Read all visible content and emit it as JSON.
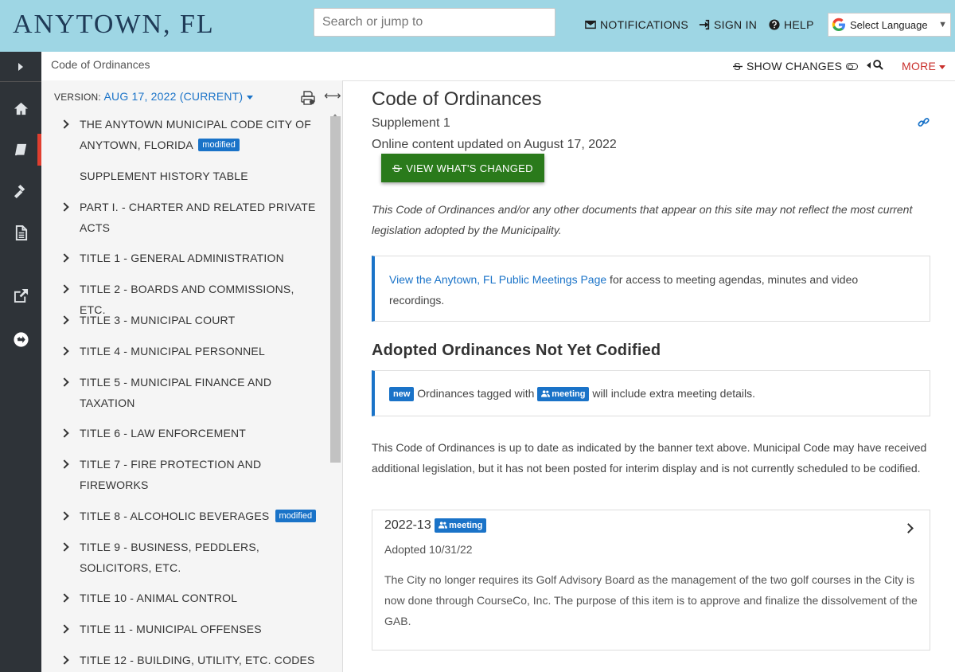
{
  "header": {
    "brand": "ANYTOWN, FL",
    "search_placeholder": "Search or jump to",
    "nav": {
      "notifications": "NOTIFICATIONS",
      "sign_in": "SIGN IN",
      "help": "HELP"
    },
    "language": "Select Language"
  },
  "subheader": {
    "breadcrumb": "Code of Ordinances",
    "show_changes": "SHOW CHANGES",
    "more": "MORE"
  },
  "toc": {
    "version_label": "VERSION:",
    "version_value": "AUG 17, 2022 (CURRENT)",
    "items": [
      {
        "label": "THE ANYTOWN MUNICIPAL CODE CITY OF ANYTOWN, FLORIDA",
        "badge": "modified",
        "expandable": true
      },
      {
        "label": "SUPPLEMENT HISTORY TABLE",
        "badge": "",
        "expandable": false
      },
      {
        "label": "PART I. - CHARTER AND RELATED PRIVATE ACTS",
        "badge": "",
        "expandable": true
      },
      {
        "label": "TITLE 1 - GENERAL ADMINISTRATION",
        "badge": "",
        "expandable": true
      },
      {
        "label": "TITLE 2 - BOARDS AND COMMISSIONS, ETC.",
        "badge": "",
        "expandable": true
      },
      {
        "label": "TITLE 3 - MUNICIPAL COURT",
        "badge": "",
        "expandable": true
      },
      {
        "label": "TITLE 4 - MUNICIPAL PERSONNEL",
        "badge": "",
        "expandable": true
      },
      {
        "label": "TITLE 5 - MUNICIPAL FINANCE AND TAXATION",
        "badge": "",
        "expandable": true
      },
      {
        "label": "TITLE 6 - LAW ENFORCEMENT",
        "badge": "",
        "expandable": true
      },
      {
        "label": "TITLE 7 - FIRE PROTECTION AND FIREWORKS",
        "badge": "",
        "expandable": true
      },
      {
        "label": "TITLE 8 - ALCOHOLIC BEVERAGES",
        "badge": "modified",
        "expandable": true
      },
      {
        "label": "TITLE 9 - BUSINESS, PEDDLERS, SOLICITORS, ETC.",
        "badge": "",
        "expandable": true
      },
      {
        "label": "TITLE 10 - ANIMAL CONTROL",
        "badge": "",
        "expandable": true
      },
      {
        "label": "TITLE 11 - MUNICIPAL OFFENSES",
        "badge": "",
        "expandable": true
      },
      {
        "label": "TITLE 12 - BUILDING, UTILITY, ETC. CODES",
        "badge": "",
        "expandable": true
      }
    ]
  },
  "main": {
    "title": "Code of Ordinances",
    "supplement": "Supplement 1",
    "updated": "Online content updated on August 17, 2022",
    "view_changed_button": "VIEW WHAT'S CHANGED",
    "disclaimer": "This Code of Ordinances and/or any other documents that appear on this site may not reflect the most current legislation adopted by the Municipality.",
    "meetings_link": "View the Anytown, FL Public Meetings Page",
    "meetings_rest": " for access to meeting agendas, minutes and video recordings.",
    "adopted_heading": "Adopted Ordinances Not Yet Codified",
    "note_new_badge": "new",
    "note_text_1": "Ordinances tagged with",
    "note_meeting_badge": "meeting",
    "note_text_2": "will include extra meeting details.",
    "status_paragraph": "This Code of Ordinances is up to date as indicated by the banner text above. Municipal Code may have received additional legislation, but it has not been posted for interim display and is not currently scheduled to be codified.",
    "ordinance": {
      "number": "2022-13",
      "badge": "meeting",
      "adopted": "Adopted 10/31/22",
      "description": "The City no longer requires its Golf Advisory Board as the management of the two golf courses in the City is now done through CourseCo, Inc. The purpose of this item is to approve and finalize the dissolvement of the GAB."
    }
  }
}
